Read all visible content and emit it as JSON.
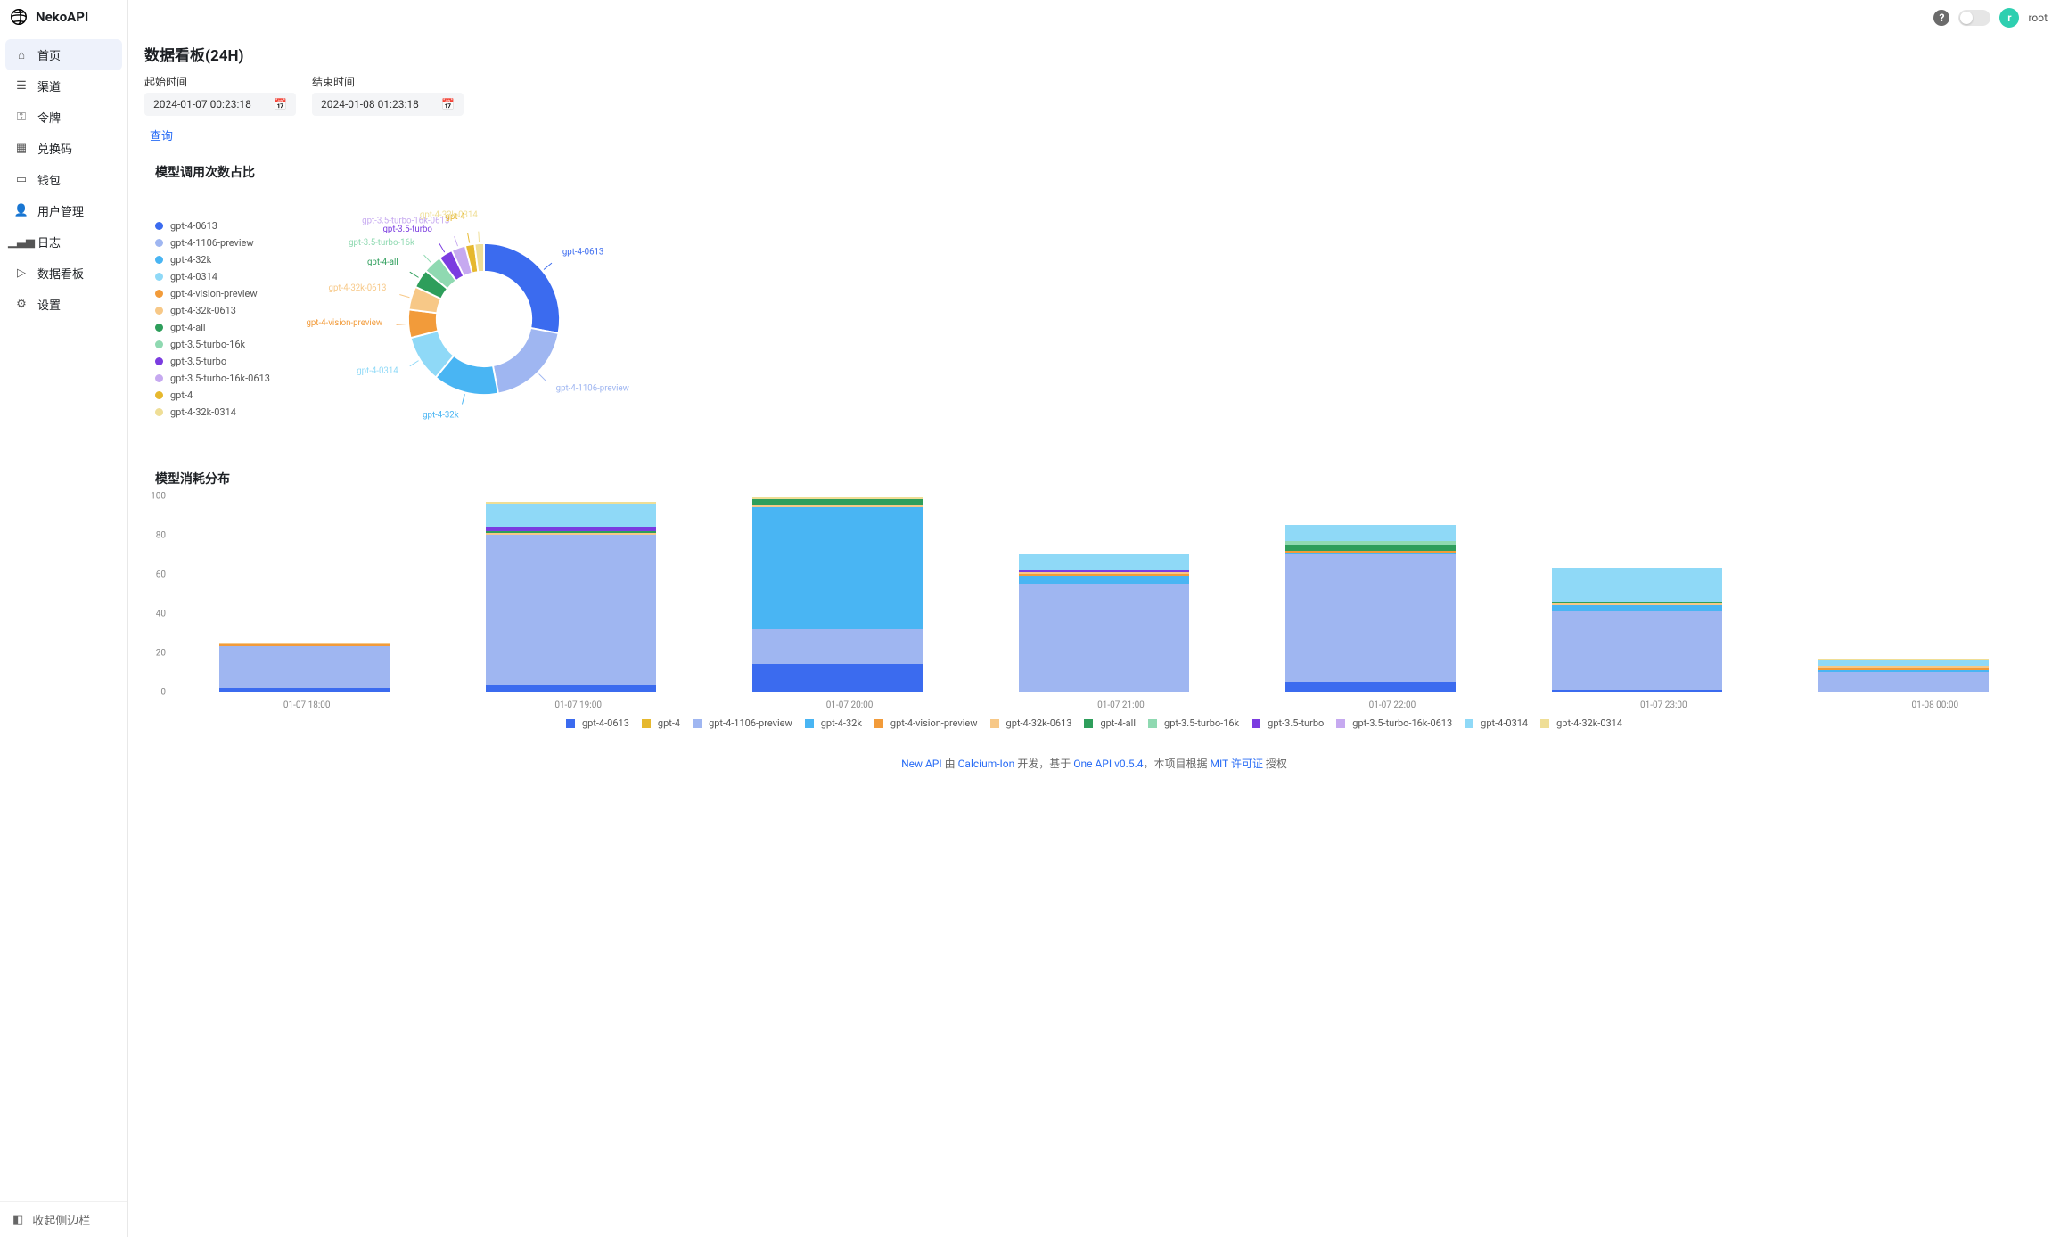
{
  "brand": "NekoAPI",
  "sidebar": {
    "items": [
      {
        "label": "首页",
        "icon": "home"
      },
      {
        "label": "渠道",
        "icon": "layers"
      },
      {
        "label": "令牌",
        "icon": "key"
      },
      {
        "label": "兑换码",
        "icon": "gift"
      },
      {
        "label": "钱包",
        "icon": "wallet"
      },
      {
        "label": "用户管理",
        "icon": "user"
      },
      {
        "label": "日志",
        "icon": "bars"
      },
      {
        "label": "数据看板",
        "icon": "play"
      },
      {
        "label": "设置",
        "icon": "gear"
      }
    ],
    "collapse": "收起侧边栏"
  },
  "topbar": {
    "username": "root",
    "avatar_initial": "r"
  },
  "page": {
    "title": "数据看板(24H)"
  },
  "filters": {
    "start_label": "起始时间",
    "end_label": "结束时间",
    "start_value": "2024-01-07 00:23:18",
    "end_value": "2024-01-08 01:23:18",
    "query": "查询"
  },
  "sections": {
    "donut_title": "模型调用次数占比",
    "bar_title": "模型消耗分布"
  },
  "colors": {
    "gpt-4-0613": "#3B6BEF",
    "gpt-4-1106-preview": "#9FB6F1",
    "gpt-4-32k": "#49B5F3",
    "gpt-4-0314": "#8FD9F7",
    "gpt-4-vision-preview": "#F29B3A",
    "gpt-4-32k-0613": "#F7C887",
    "gpt-4-all": "#2E9E5B",
    "gpt-3.5-turbo-16k": "#8FD9B1",
    "gpt-3.5-turbo": "#7B3CE0",
    "gpt-3.5-turbo-16k-0613": "#C6A9F0",
    "gpt-4": "#E6B82E",
    "gpt-4-32k-0314": "#EFDE96"
  },
  "chart_data": [
    {
      "type": "pie",
      "title": "模型调用次数占比",
      "series_key": "model",
      "data": [
        {
          "label": "gpt-4-0613",
          "value": 28
        },
        {
          "label": "gpt-4-1106-preview",
          "value": 19
        },
        {
          "label": "gpt-4-32k",
          "value": 14
        },
        {
          "label": "gpt-4-0314",
          "value": 10
        },
        {
          "label": "gpt-4-vision-preview",
          "value": 6
        },
        {
          "label": "gpt-4-32k-0613",
          "value": 5
        },
        {
          "label": "gpt-4-all",
          "value": 4
        },
        {
          "label": "gpt-3.5-turbo-16k",
          "value": 4
        },
        {
          "label": "gpt-3.5-turbo",
          "value": 3
        },
        {
          "label": "gpt-3.5-turbo-16k-0613",
          "value": 3
        },
        {
          "label": "gpt-4",
          "value": 2
        },
        {
          "label": "gpt-4-32k-0314",
          "value": 2
        }
      ]
    },
    {
      "type": "bar",
      "title": "模型消耗分布",
      "stacked": true,
      "ylim": [
        0,
        100
      ],
      "yticks": [
        0,
        20,
        40,
        60,
        80,
        100
      ],
      "categories": [
        "01-07 18:00",
        "01-07 19:00",
        "01-07 20:00",
        "01-07 21:00",
        "01-07 22:00",
        "01-07 23:00",
        "01-08 00:00"
      ],
      "series": [
        {
          "name": "gpt-4-0613",
          "values": [
            2,
            3,
            14,
            0,
            5,
            1,
            0
          ]
        },
        {
          "name": "gpt-4",
          "values": [
            0,
            0,
            0,
            0,
            0,
            0,
            0
          ]
        },
        {
          "name": "gpt-4-1106-preview",
          "values": [
            21,
            77,
            18,
            55,
            65,
            40,
            10
          ]
        },
        {
          "name": "gpt-4-32k",
          "values": [
            0,
            0,
            62,
            4,
            1,
            3,
            1
          ]
        },
        {
          "name": "gpt-4-vision-preview",
          "values": [
            1,
            0,
            0,
            1,
            1,
            0,
            1
          ]
        },
        {
          "name": "gpt-4-32k-0613",
          "values": [
            1,
            1,
            1,
            1,
            0,
            1,
            1
          ]
        },
        {
          "name": "gpt-4-all",
          "values": [
            0,
            1,
            3,
            0,
            3,
            1,
            0
          ]
        },
        {
          "name": "gpt-3.5-turbo-16k",
          "values": [
            0,
            0,
            0,
            0,
            2,
            0,
            0
          ]
        },
        {
          "name": "gpt-3.5-turbo",
          "values": [
            0,
            2,
            0,
            1,
            0,
            0,
            0
          ]
        },
        {
          "name": "gpt-3.5-turbo-16k-0613",
          "values": [
            0,
            0,
            0,
            0,
            0,
            0,
            0
          ]
        },
        {
          "name": "gpt-4-0314",
          "values": [
            0,
            12,
            0,
            8,
            8,
            17,
            3
          ]
        },
        {
          "name": "gpt-4-32k-0314",
          "values": [
            0,
            1,
            1,
            0,
            0,
            0,
            1
          ]
        }
      ]
    }
  ],
  "footer": {
    "parts": [
      "New API",
      " 由 ",
      "Calcium-Ion",
      " 开发，基于 ",
      "One API v0.5.4",
      "，本项目根据 ",
      "MIT 许可证",
      " 授权"
    ]
  }
}
